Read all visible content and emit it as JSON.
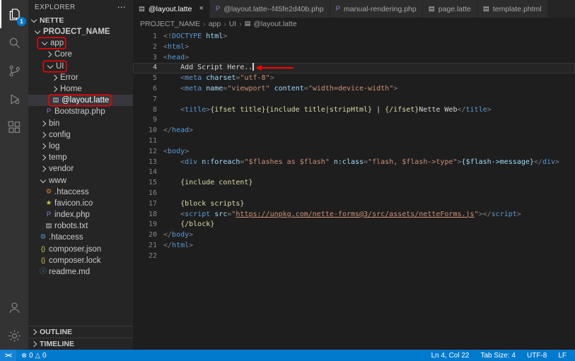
{
  "activity_bar": {
    "badge": "1"
  },
  "sidebar": {
    "title": "EXPLORER",
    "section": "NETTE",
    "outline_label": "OUTLINE",
    "timeline_label": "TIMELINE",
    "tree": [
      {
        "label": "PROJECT_NAME",
        "level": 0,
        "chevron": "down",
        "bold": true
      },
      {
        "label": "app",
        "level": 1,
        "chevron": "down",
        "boxed": true
      },
      {
        "label": "Core",
        "level": 2,
        "chevron": "right"
      },
      {
        "label": "UI",
        "level": 2,
        "chevron": "down",
        "boxed": true
      },
      {
        "label": "Error",
        "level": 3,
        "chevron": "right"
      },
      {
        "label": "Home",
        "level": 3,
        "chevron": "right"
      },
      {
        "label": "@layout.latte",
        "level": 3,
        "icon": "file",
        "icon_color": "#c5c5c5",
        "selected": true,
        "boxed": true
      },
      {
        "label": "Bootstrap.php",
        "level": 2,
        "icon": "php",
        "icon_color": "#a074c4"
      },
      {
        "label": "bin",
        "level": 1,
        "chevron": "right"
      },
      {
        "label": "config",
        "level": 1,
        "chevron": "right"
      },
      {
        "label": "log",
        "level": 1,
        "chevron": "right"
      },
      {
        "label": "temp",
        "level": 1,
        "chevron": "right"
      },
      {
        "label": "vendor",
        "level": 1,
        "chevron": "right"
      },
      {
        "label": "www",
        "level": 1,
        "chevron": "down"
      },
      {
        "label": ".htaccess",
        "level": 2,
        "icon": "gear",
        "icon_color": "#e37933"
      },
      {
        "label": "favicon.ico",
        "level": 2,
        "icon": "star",
        "icon_color": "#cbcb41"
      },
      {
        "label": "index.php",
        "level": 2,
        "icon": "php",
        "icon_color": "#a074c4"
      },
      {
        "label": "robots.txt",
        "level": 2,
        "icon": "file",
        "icon_color": "#c5c5c5"
      },
      {
        "label": ".htaccess",
        "level": 1,
        "icon": "gear",
        "icon_color": "#519aba"
      },
      {
        "label": "composer.json",
        "level": 1,
        "icon": "braces",
        "icon_color": "#cbcb41"
      },
      {
        "label": "composer.lock",
        "level": 1,
        "icon": "braces",
        "icon_color": "#cbcb41"
      },
      {
        "label": "readme.md",
        "level": 1,
        "icon": "info",
        "icon_color": "#519aba"
      }
    ]
  },
  "tabs": [
    {
      "label": "@layout.latte",
      "icon": "file",
      "icon_color": "#c5c5c5",
      "active": true
    },
    {
      "label": "@layout.latte--f45fe2d40b.php",
      "icon": "php",
      "icon_color": "#a074c4",
      "active": false
    },
    {
      "label": "manual-rendering.php",
      "icon": "php",
      "icon_color": "#a074c4",
      "active": false
    },
    {
      "label": "page.latte",
      "icon": "file",
      "icon_color": "#c5c5c5",
      "active": false
    },
    {
      "label": "template.phtml",
      "icon": "file",
      "icon_color": "#c5c5c5",
      "active": false
    }
  ],
  "breadcrumb": {
    "items": [
      "PROJECT_NAME",
      "app",
      "UI",
      "@layout.latte"
    ]
  },
  "editor": {
    "cursor_line": 4,
    "lines": [
      [
        [
          "p",
          "<!"
        ],
        [
          "t",
          "DOCTYPE"
        ],
        [
          "a",
          " html"
        ],
        [
          "p",
          ">"
        ]
      ],
      [
        [
          "p",
          "<"
        ],
        [
          "t",
          "html"
        ],
        [
          "p",
          ">"
        ]
      ],
      [
        [
          "p",
          "<"
        ],
        [
          "t",
          "head"
        ],
        [
          "p",
          ">"
        ]
      ],
      [
        [
          "x",
          "    Add Script Here.."
        ]
      ],
      [
        [
          "x",
          "    "
        ],
        [
          "p",
          "<"
        ],
        [
          "t",
          "meta"
        ],
        [
          "x",
          " "
        ],
        [
          "a",
          "charset"
        ],
        [
          "p",
          "="
        ],
        [
          "s",
          "\"utf-8\""
        ],
        [
          "p",
          ">"
        ]
      ],
      [
        [
          "x",
          "    "
        ],
        [
          "p",
          "<"
        ],
        [
          "t",
          "meta"
        ],
        [
          "x",
          " "
        ],
        [
          "a",
          "name"
        ],
        [
          "p",
          "="
        ],
        [
          "s",
          "\"viewport\""
        ],
        [
          "x",
          " "
        ],
        [
          "a",
          "content"
        ],
        [
          "p",
          "="
        ],
        [
          "s",
          "\"width=device-width\""
        ],
        [
          "p",
          ">"
        ]
      ],
      [],
      [
        [
          "x",
          "    "
        ],
        [
          "p",
          "<"
        ],
        [
          "t",
          "title"
        ],
        [
          "p",
          ">"
        ],
        [
          "m",
          "{ifset title}{include title|stripHtml}"
        ],
        [
          "x",
          " | "
        ],
        [
          "m",
          "{/ifset}"
        ],
        [
          "x",
          "Nette Web"
        ],
        [
          "p",
          "</"
        ],
        [
          "t",
          "title"
        ],
        [
          "p",
          ">"
        ]
      ],
      [],
      [
        [
          "p",
          "</"
        ],
        [
          "t",
          "head"
        ],
        [
          "p",
          ">"
        ]
      ],
      [],
      [
        [
          "p",
          "<"
        ],
        [
          "t",
          "body"
        ],
        [
          "p",
          ">"
        ]
      ],
      [
        [
          "x",
          "    "
        ],
        [
          "p",
          "<"
        ],
        [
          "t",
          "div"
        ],
        [
          "x",
          " "
        ],
        [
          "a",
          "n:foreach"
        ],
        [
          "p",
          "="
        ],
        [
          "s",
          "\"$flashes as $flash\""
        ],
        [
          "x",
          " "
        ],
        [
          "a",
          "n:class"
        ],
        [
          "p",
          "="
        ],
        [
          "s",
          "\"flash, $flash->type\""
        ],
        [
          "p",
          ">"
        ],
        [
          "v",
          "{$flash->message}"
        ],
        [
          "p",
          "</"
        ],
        [
          "t",
          "div"
        ],
        [
          "p",
          ">"
        ]
      ],
      [],
      [
        [
          "x",
          "    "
        ],
        [
          "m",
          "{include content}"
        ]
      ],
      [],
      [
        [
          "x",
          "    "
        ],
        [
          "m",
          "{block scripts}"
        ]
      ],
      [
        [
          "x",
          "    "
        ],
        [
          "p",
          "<"
        ],
        [
          "t",
          "script"
        ],
        [
          "x",
          " "
        ],
        [
          "a",
          "src"
        ],
        [
          "p",
          "="
        ],
        [
          "s",
          "\""
        ],
        [
          "l",
          "https://unpkg.com/nette-forms@3/src/assets/netteForms.js"
        ],
        [
          "s",
          "\""
        ],
        [
          "p",
          "></"
        ],
        [
          "t",
          "script"
        ],
        [
          "p",
          ">"
        ]
      ],
      [
        [
          "x",
          "    "
        ],
        [
          "m",
          "{/block}"
        ]
      ],
      [
        [
          "p",
          "</"
        ],
        [
          "t",
          "body"
        ],
        [
          "p",
          ">"
        ]
      ],
      [
        [
          "p",
          "</"
        ],
        [
          "t",
          "html"
        ],
        [
          "p",
          ">"
        ]
      ],
      []
    ]
  },
  "status_bar": {
    "remote_label": "><",
    "errors_icon": "⊗",
    "errors": "0",
    "warnings_icon": "△",
    "warnings": "0",
    "right_items": [
      "Ln 4, Col 22",
      "Tab Size: 4",
      "UTF-8",
      "LF"
    ]
  },
  "icon_glyphs": {
    "file": "▤",
    "php": "P",
    "gear": "⚙",
    "star": "★",
    "braces": "{}",
    "info": "ⓘ",
    "more": "⋯",
    "close": "×",
    "crumb_sep": "›"
  },
  "colors": {
    "accent": "#007acc",
    "annotation_red": "#ff0000",
    "selection": "#37373d"
  }
}
